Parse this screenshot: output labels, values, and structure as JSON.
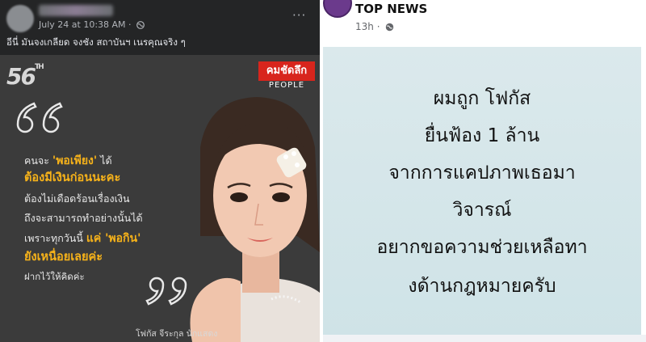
{
  "left_post": {
    "timestamp": "July 24 at 10:38 AM · ",
    "caption": "อีนี่ มันจงเกลียด จงชัง สถาบันฯ  เนรคุณจริง ๆ",
    "more_label": "···",
    "image": {
      "badge": "56",
      "brand": "คมชัดลึก",
      "brand_sub": "PEOPLE",
      "quote_line1_pre": "คนจะ ",
      "quote_line1_hl": "'พอเพียง'",
      "quote_line1_post": " ได้",
      "quote_line2": "ต้องมีเงินก่อนนะคะ",
      "quote_line3": "ต้องไม่เดือดร้อนเรื่องเงิน",
      "quote_line4": "ถึงจะสามารถทำอย่างนั้นได้",
      "quote_line5_pre": "เพราะทุกวันนี้ ",
      "quote_line5_hl": "แค่ 'พอกิน'",
      "quote_line6": "ยังเหนื่อยเลยค่ะ",
      "quote_line7": "ฝากไว้ให้คิดค่ะ",
      "credit": "โฟกัส จีระกุล  นักแสดง"
    },
    "colors": {
      "background": "#242526",
      "accent_yellow": "#f6b21a",
      "brand_red": "#d8251d"
    }
  },
  "right_post": {
    "page_name": "TOP NEWS",
    "time": "13h · ",
    "content_lines": [
      "ผมถูก โฟกัส",
      "ยื่นฟ้อง 1 ล้าน",
      "จากการแคปภาพเธอมา",
      "วิจารณ์",
      "อยากขอความช่วยเหลือทา",
      "งด้านกฎหมายครับ"
    ],
    "colors": {
      "content_bg": "#d5e6ea"
    }
  }
}
